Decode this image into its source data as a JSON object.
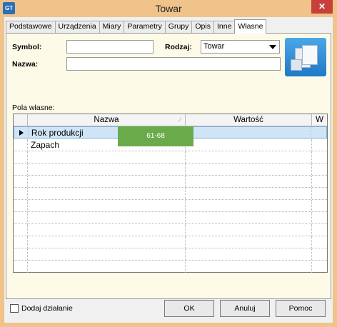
{
  "window": {
    "title": "Towar",
    "app_icon": "GT",
    "close_symbol": "✕"
  },
  "tabs": [
    "Podstawowe",
    "Urządzenia",
    "Miary",
    "Parametry",
    "Grupy",
    "Opis",
    "Inne",
    "Własne"
  ],
  "active_tab": "Własne",
  "form": {
    "symbol_label": "Symbol:",
    "symbol_value": "",
    "rodzaj_label": "Rodzaj:",
    "rodzaj_value": "Towar",
    "nazwa_label": "Nazwa:",
    "nazwa_value": ""
  },
  "custom_fields": {
    "label": "Pola własne:",
    "columns": [
      "Nazwa",
      "Wartość",
      "W"
    ],
    "rows": [
      {
        "nazwa": "Rok produkcji",
        "wartosc": "",
        "w": "",
        "selected": true
      },
      {
        "nazwa": "Zapach",
        "wartosc": "",
        "w": "",
        "selected": false
      }
    ],
    "sort_glyph": "⁄"
  },
  "overlay_badge": "61-68",
  "footer": {
    "add_action_label": "Dodaj działanie",
    "add_action_checked": false,
    "ok_label": "OK",
    "cancel_label": "Anuluj",
    "help_label": "Pomoc"
  },
  "colors": {
    "frame": "#f0c38a",
    "panel": "#fdfbe8",
    "selection": "#cfe5f7",
    "badge": "#6aaa4a",
    "close": "#c7413a"
  }
}
